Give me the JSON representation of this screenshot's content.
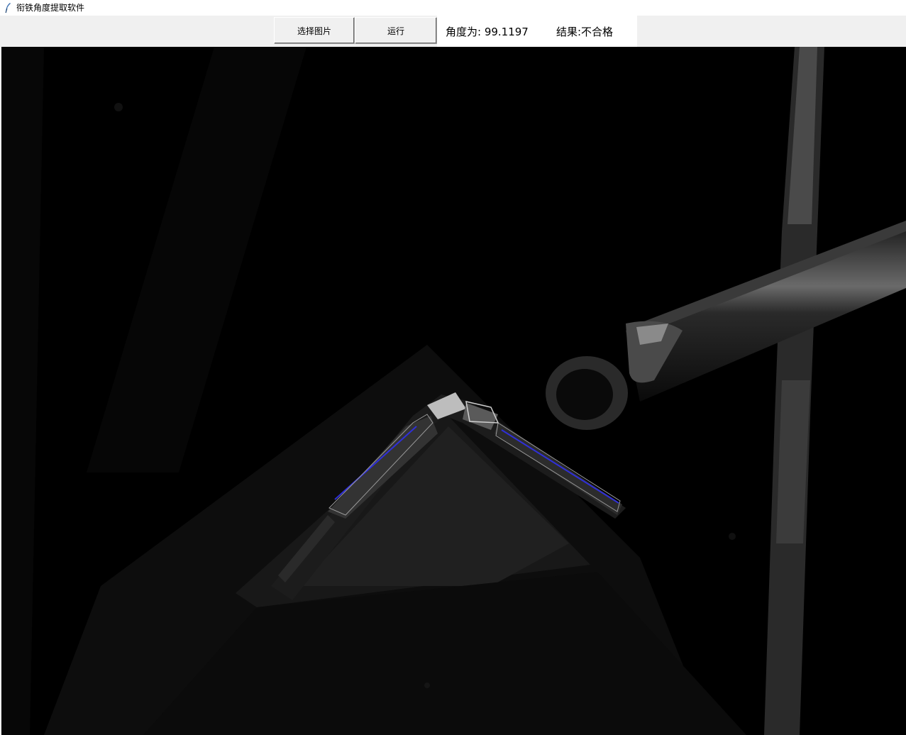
{
  "window": {
    "title": "衔铁角度提取软件",
    "icon": "feather-icon"
  },
  "toolbar": {
    "select_image_label": "选择图片",
    "run_label": "运行"
  },
  "status": {
    "angle_text": "角度为: 99.1197",
    "result_text": "结果:不合格"
  },
  "image": {
    "description_icon": "processed-camera-image",
    "line_color": "#2f2fd8"
  }
}
